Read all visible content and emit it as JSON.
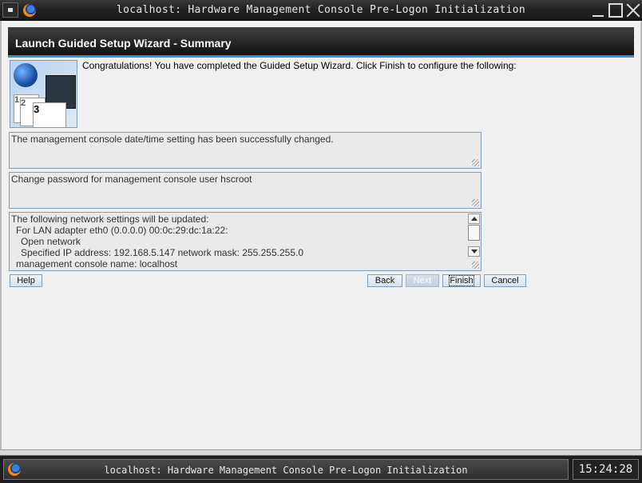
{
  "window": {
    "title": "localhost: Hardware Management Console Pre-Logon Initialization"
  },
  "wizard": {
    "header": "Launch Guided Setup Wizard - Summary",
    "intro": "Congratulations! You have completed the Guided Setup Wizard. Click Finish to configure the following:",
    "image_step_numbers": [
      "1",
      "2",
      "3"
    ],
    "summary_datetime": "The management console date/time setting has been successfully changed.",
    "summary_password": "Change password for management console user hscroot",
    "network_lines": [
      "The following network settings will be updated:",
      "  For LAN adapter eth0 (0.0.0.0) 00:0c:29:dc:1a:22:",
      "    Open network",
      "    Specified IP address: 192.168.5.147 network mask: 255.255.255.0",
      "  management console name: localhost"
    ]
  },
  "buttons": {
    "help": "Help",
    "back": "Back",
    "next": "Next",
    "finish": "Finish",
    "cancel": "Cancel"
  },
  "taskbar": {
    "task_title": "localhost: Hardware Management Console Pre-Logon Initialization",
    "clock": "15:24:28"
  }
}
